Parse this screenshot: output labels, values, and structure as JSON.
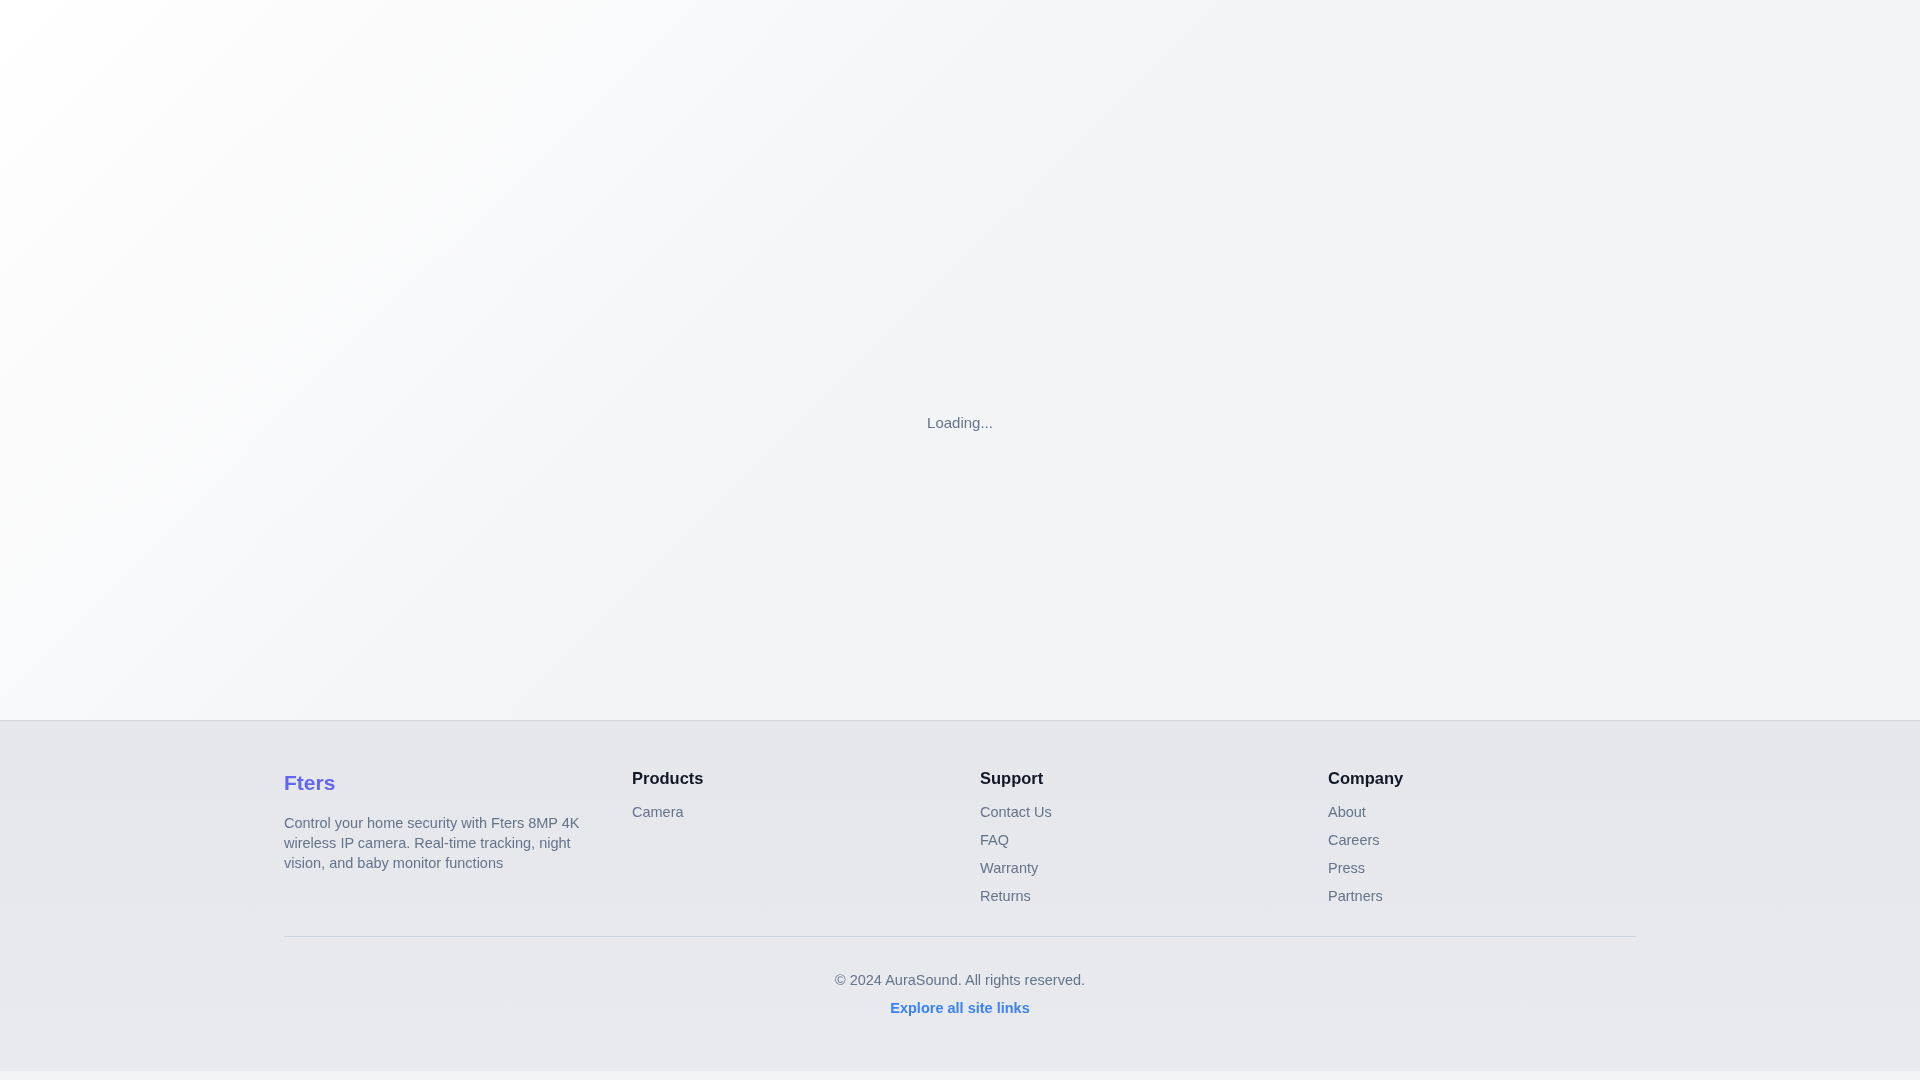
{
  "main": {
    "status": "Loading..."
  },
  "footer": {
    "brand": {
      "logo": "Fters",
      "description": "Control your home security with Fters 8MP 4K wireless IP camera. Real-time tracking, night vision, and baby monitor functions"
    },
    "columns": [
      {
        "heading": "Products",
        "links": [
          "Camera"
        ]
      },
      {
        "heading": "Support",
        "links": [
          "Contact Us",
          "FAQ",
          "Warranty",
          "Returns"
        ]
      },
      {
        "heading": "Company",
        "links": [
          "About",
          "Careers",
          "Press",
          "Partners"
        ]
      }
    ],
    "copyright": "© 2024 AuraSound. All rights reserved.",
    "explore_link": "Explore all site links"
  }
}
